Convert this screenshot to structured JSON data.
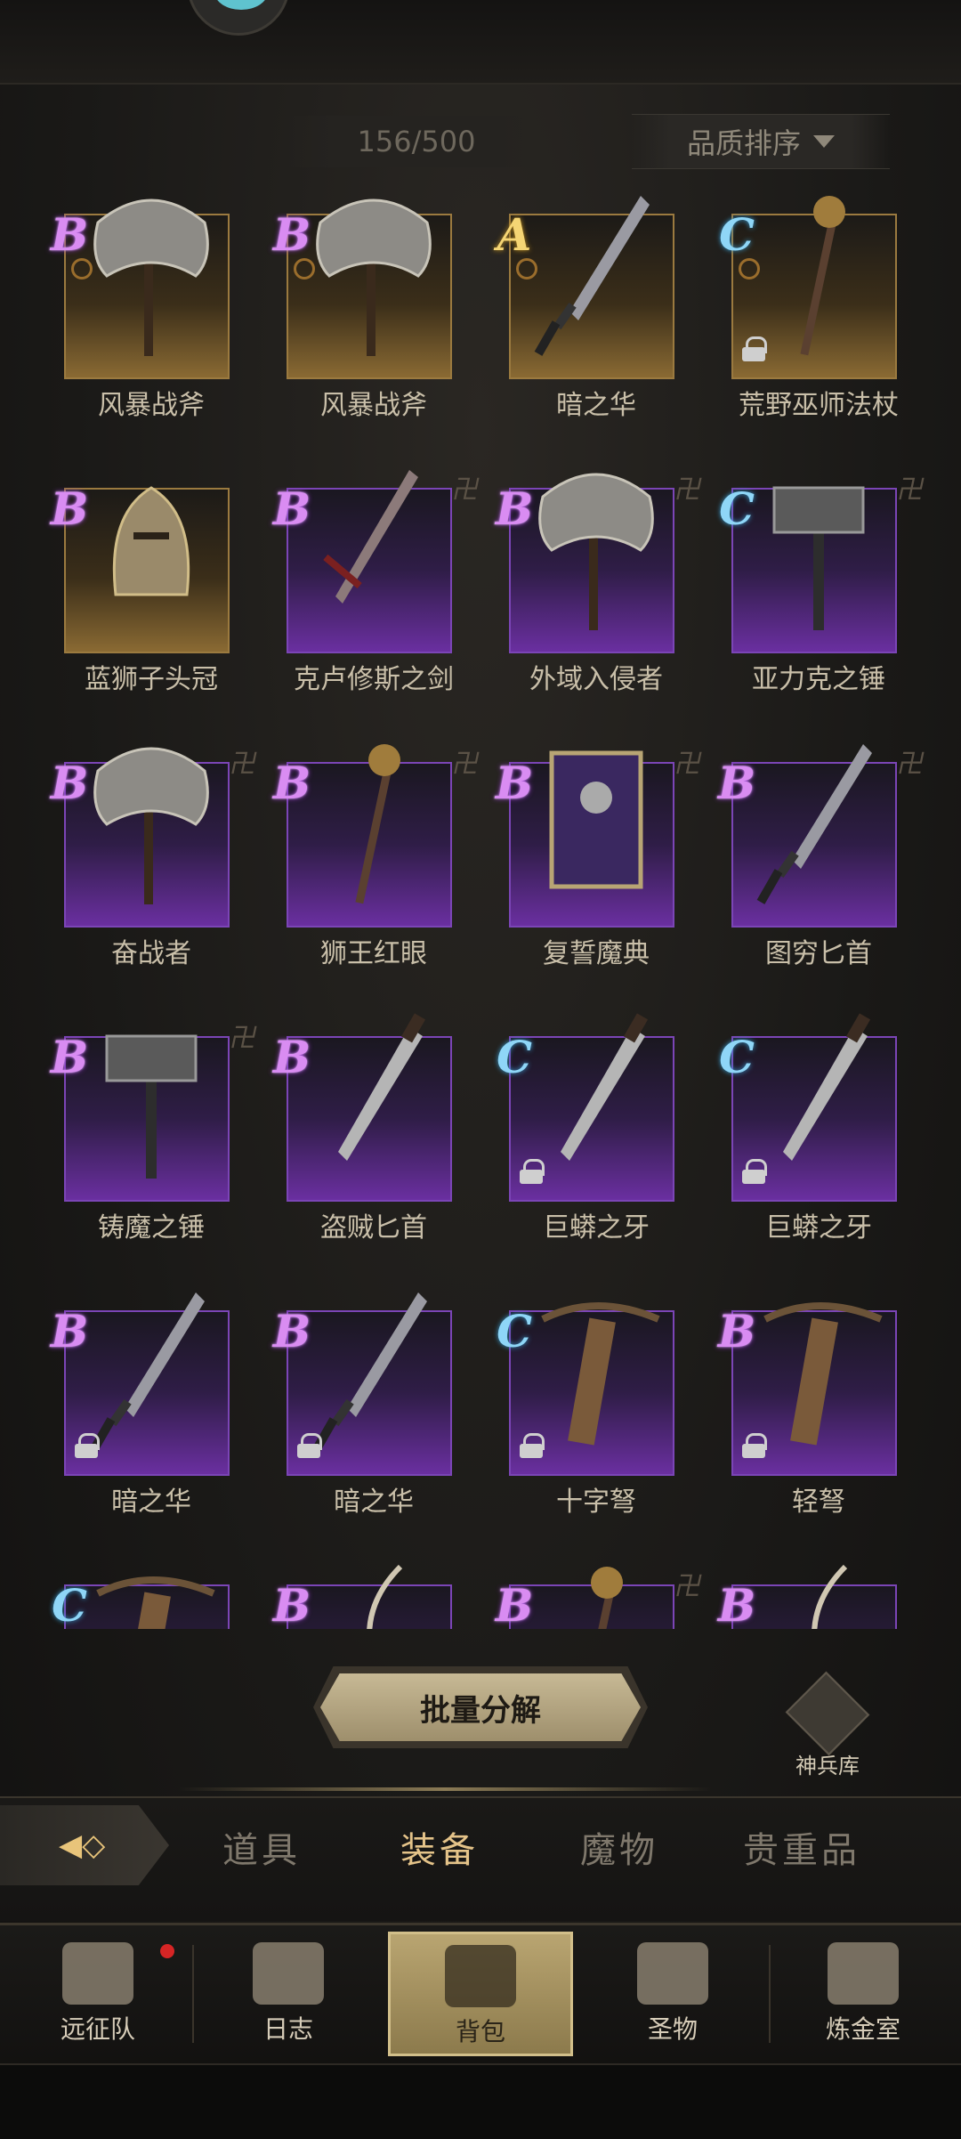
{
  "inventory": {
    "count": "156/500",
    "sort_label": "品质排序",
    "items": [
      {
        "name": "风暴战斧",
        "grade": "B",
        "bg": "gold",
        "ring": true,
        "lock": false,
        "rune": false,
        "weapon": "axe"
      },
      {
        "name": "风暴战斧",
        "grade": "B",
        "bg": "gold",
        "ring": true,
        "lock": false,
        "rune": false,
        "weapon": "axe"
      },
      {
        "name": "暗之华",
        "grade": "A",
        "bg": "gold",
        "ring": true,
        "lock": false,
        "rune": false,
        "weapon": "dagger"
      },
      {
        "name": "荒野巫师法杖",
        "grade": "C",
        "bg": "gold",
        "ring": true,
        "lock": true,
        "rune": false,
        "weapon": "staff"
      },
      {
        "name": "蓝狮子头冠",
        "grade": "B",
        "bg": "gold",
        "ring": false,
        "lock": false,
        "rune": false,
        "weapon": "helm"
      },
      {
        "name": "克卢修斯之剑",
        "grade": "B",
        "bg": "purple",
        "ring": false,
        "lock": false,
        "rune": true,
        "weapon": "sword"
      },
      {
        "name": "外域入侵者",
        "grade": "B",
        "bg": "purple",
        "ring": false,
        "lock": false,
        "rune": true,
        "weapon": "axe"
      },
      {
        "name": "亚力克之锤",
        "grade": "C",
        "bg": "purple",
        "ring": false,
        "lock": false,
        "rune": true,
        "weapon": "hammer"
      },
      {
        "name": "奋战者",
        "grade": "B",
        "bg": "purple",
        "ring": false,
        "lock": false,
        "rune": true,
        "weapon": "axe"
      },
      {
        "name": "狮王红眼",
        "grade": "B",
        "bg": "purple",
        "ring": false,
        "lock": false,
        "rune": true,
        "weapon": "staff"
      },
      {
        "name": "复誓魔典",
        "grade": "B",
        "bg": "purple",
        "ring": false,
        "lock": false,
        "rune": true,
        "weapon": "book"
      },
      {
        "name": "图穷匕首",
        "grade": "B",
        "bg": "purple",
        "ring": false,
        "lock": false,
        "rune": true,
        "weapon": "dagger"
      },
      {
        "name": "铸魔之锤",
        "grade": "B",
        "bg": "purple",
        "ring": false,
        "lock": false,
        "rune": true,
        "weapon": "hammer"
      },
      {
        "name": "盗贼匕首",
        "grade": "B",
        "bg": "purple",
        "ring": false,
        "lock": false,
        "rune": false,
        "weapon": "knife"
      },
      {
        "name": "巨蟒之牙",
        "grade": "C",
        "bg": "purple",
        "ring": false,
        "lock": true,
        "rune": false,
        "weapon": "knife"
      },
      {
        "name": "巨蟒之牙",
        "grade": "C",
        "bg": "purple",
        "ring": false,
        "lock": true,
        "rune": false,
        "weapon": "knife"
      },
      {
        "name": "暗之华",
        "grade": "B",
        "bg": "purple",
        "ring": false,
        "lock": true,
        "rune": false,
        "weapon": "dagger"
      },
      {
        "name": "暗之华",
        "grade": "B",
        "bg": "purple",
        "ring": false,
        "lock": true,
        "rune": false,
        "weapon": "dagger"
      },
      {
        "name": "十字弩",
        "grade": "C",
        "bg": "purple",
        "ring": false,
        "lock": true,
        "rune": false,
        "weapon": "crossbow"
      },
      {
        "name": "轻弩",
        "grade": "B",
        "bg": "purple",
        "ring": false,
        "lock": true,
        "rune": false,
        "weapon": "crossbow"
      },
      {
        "name": "",
        "grade": "C",
        "bg": "purple",
        "ring": false,
        "lock": false,
        "rune": false,
        "weapon": "crossbow"
      },
      {
        "name": "",
        "grade": "B",
        "bg": "purple",
        "ring": false,
        "lock": false,
        "rune": false,
        "weapon": "bow"
      },
      {
        "name": "",
        "grade": "B",
        "bg": "purple",
        "ring": false,
        "lock": false,
        "rune": true,
        "weapon": "staff"
      },
      {
        "name": "",
        "grade": "B",
        "bg": "purple",
        "ring": false,
        "lock": false,
        "rune": false,
        "weapon": "bow"
      }
    ]
  },
  "actions": {
    "batch_decompose": "批量分解",
    "armory_label": "神兵库"
  },
  "category_tabs": {
    "items": [
      "道具",
      "装备",
      "魔物",
      "贵重品"
    ],
    "active_index": 1
  },
  "bottom_nav": {
    "items": [
      {
        "label": "远征队",
        "icon": "helmet-icon",
        "badge": true
      },
      {
        "label": "日志",
        "icon": "scroll-icon",
        "badge": false
      },
      {
        "label": "背包",
        "icon": "bag-icon",
        "badge": false
      },
      {
        "label": "圣物",
        "icon": "relic-icon",
        "badge": false
      },
      {
        "label": "炼金室",
        "icon": "alchemy-icon",
        "badge": false
      }
    ],
    "active_index": 2
  },
  "colors": {
    "grade_B": "#d98cf2",
    "grade_A": "#f5d574",
    "grade_C": "#8fd6f7",
    "accent": "#e4c389"
  }
}
